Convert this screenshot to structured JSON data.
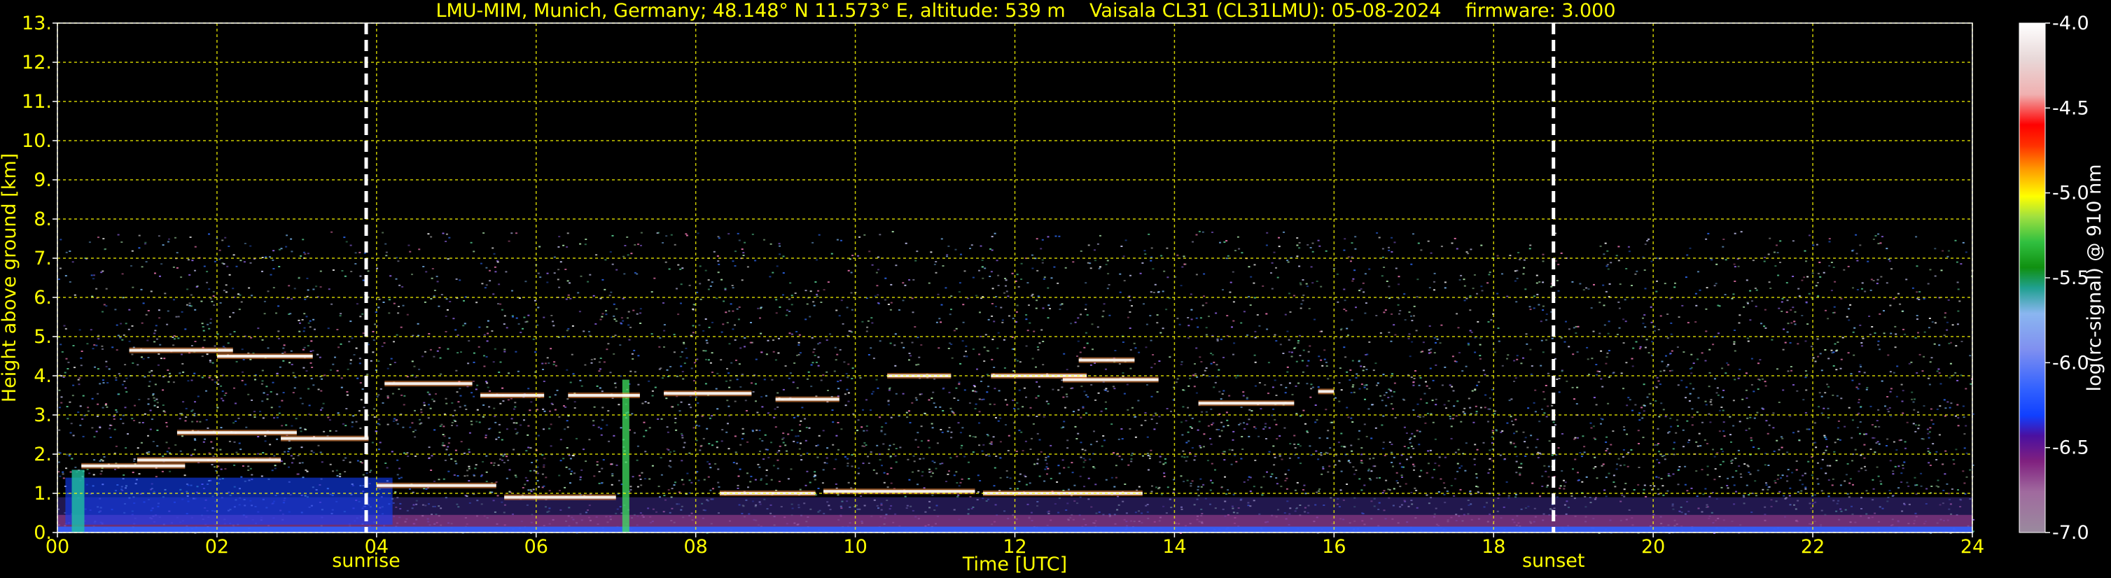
{
  "chart_data": {
    "type": "heatmap",
    "title": "LMU-MIM, Munich, Germany; 48.148° N 11.573° E, altitude: 539 m    Vaisala CL31 (CL31LMU): 05-08-2024    firmware: 3.000",
    "xlabel": "Time [UTC]",
    "ylabel": "Height above ground [km]",
    "xlim": [
      0,
      24
    ],
    "ylim": [
      0,
      13
    ],
    "x_ticks": [
      "00",
      "02",
      "04",
      "06",
      "08",
      "10",
      "12",
      "14",
      "16",
      "18",
      "20",
      "22",
      "24"
    ],
    "y_ticks": [
      "0.",
      "1.",
      "2.",
      "3.",
      "4.",
      "5.",
      "6.",
      "7.",
      "8.",
      "9.",
      "10.",
      "11.",
      "12.",
      "13."
    ],
    "grid": true,
    "events": [
      {
        "label": "sunrise",
        "x": 3.87
      },
      {
        "label": "sunset",
        "x": 18.75
      }
    ],
    "colorbar": {
      "label": "log(rc-signal) @ 910 nm",
      "range": [
        -7.0,
        -4.0
      ],
      "ticks": [
        "-4.0",
        "-4.5",
        "-5.0",
        "-5.5",
        "-6.0",
        "-6.5",
        "-7.0"
      ]
    },
    "signal_top_km": 7.7,
    "cloud_layers": [
      {
        "x0": 0.3,
        "x1": 1.6,
        "y": 1.7
      },
      {
        "x0": 1.0,
        "x1": 2.8,
        "y": 1.85
      },
      {
        "x0": 1.5,
        "x1": 3.0,
        "y": 2.55
      },
      {
        "x0": 2.8,
        "x1": 3.9,
        "y": 2.4
      },
      {
        "x0": 0.9,
        "x1": 2.2,
        "y": 4.65
      },
      {
        "x0": 2.0,
        "x1": 3.2,
        "y": 4.5
      },
      {
        "x0": 4.1,
        "x1": 5.2,
        "y": 3.8
      },
      {
        "x0": 5.3,
        "x1": 6.1,
        "y": 3.5
      },
      {
        "x0": 6.4,
        "x1": 7.3,
        "y": 3.5
      },
      {
        "x0": 7.6,
        "x1": 8.7,
        "y": 3.55
      },
      {
        "x0": 9.0,
        "x1": 9.8,
        "y": 3.4
      },
      {
        "x0": 10.4,
        "x1": 11.2,
        "y": 4.0
      },
      {
        "x0": 11.7,
        "x1": 12.9,
        "y": 4.0
      },
      {
        "x0": 12.6,
        "x1": 13.8,
        "y": 3.9
      },
      {
        "x0": 12.8,
        "x1": 13.5,
        "y": 4.4
      },
      {
        "x0": 14.3,
        "x1": 15.5,
        "y": 3.3
      },
      {
        "x0": 15.8,
        "x1": 16.0,
        "y": 3.6
      },
      {
        "x0": 4.0,
        "x1": 5.5,
        "y": 1.2
      },
      {
        "x0": 5.6,
        "x1": 7.0,
        "y": 0.9
      },
      {
        "x0": 8.3,
        "x1": 9.5,
        "y": 1.0
      },
      {
        "x0": 9.6,
        "x1": 11.5,
        "y": 1.05
      },
      {
        "x0": 11.6,
        "x1": 13.6,
        "y": 1.0
      }
    ],
    "colors": {
      "background": "#000000",
      "axis_text": "#ffff00",
      "grid": "#ffff00",
      "event_line": "#ffffff"
    }
  }
}
